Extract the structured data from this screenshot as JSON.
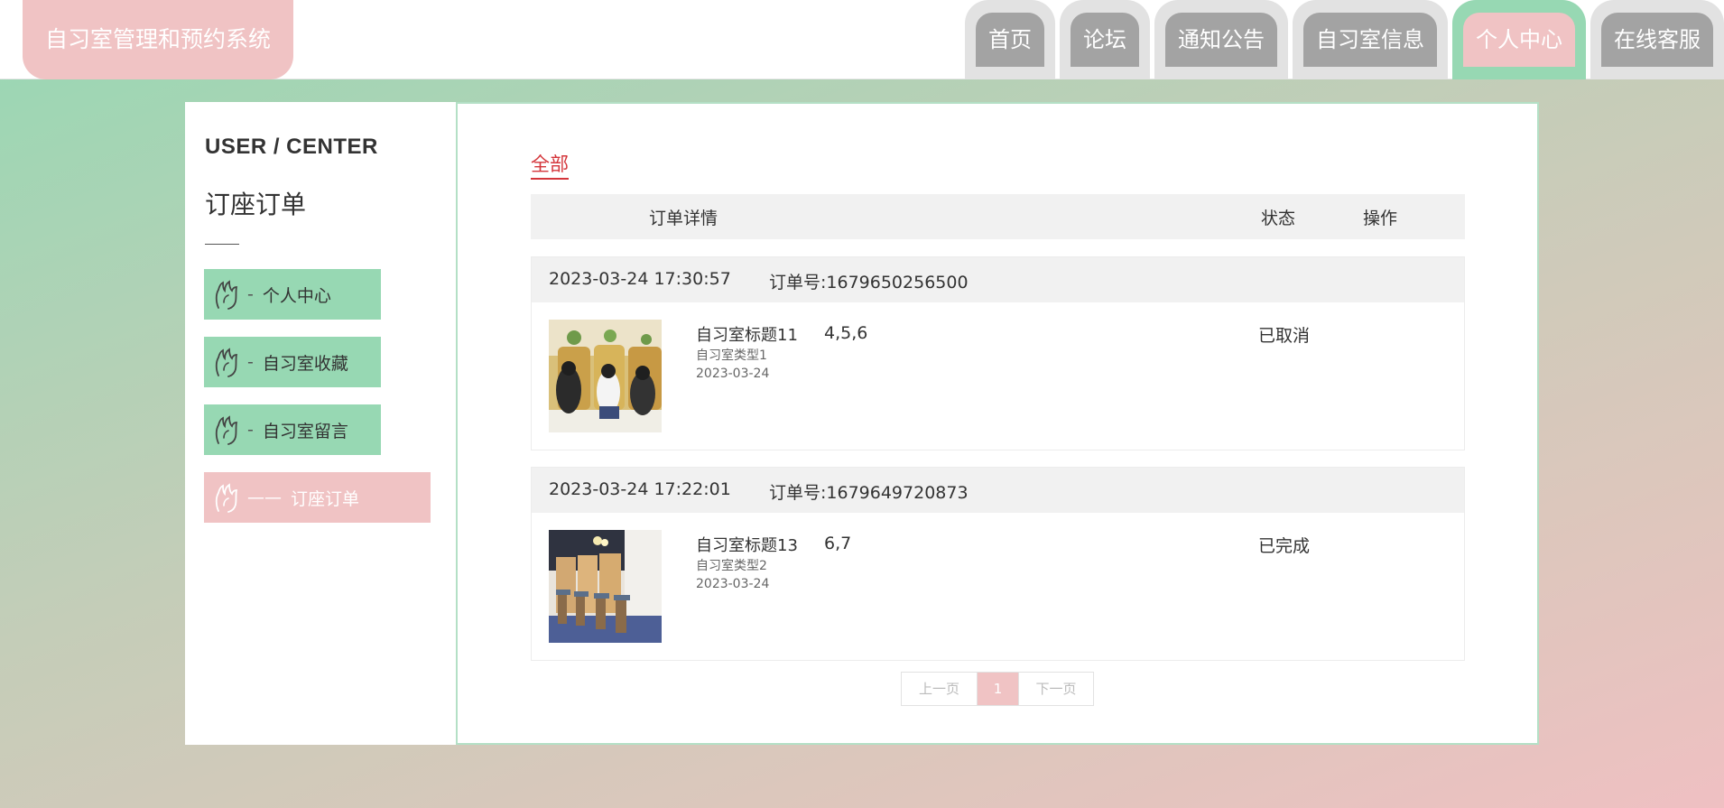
{
  "header": {
    "brand": "自习室管理和预约系统",
    "nav": [
      {
        "label": "首页",
        "active": false
      },
      {
        "label": "论坛",
        "active": false
      },
      {
        "label": "通知公告",
        "active": false
      },
      {
        "label": "自习室信息",
        "active": false
      },
      {
        "label": "个人中心",
        "active": true
      },
      {
        "label": "在线客服",
        "active": false
      }
    ]
  },
  "sidebar": {
    "eyebrow": "USER / CENTER",
    "title": "订座订单",
    "menu_icon": "hand-icon",
    "items": [
      {
        "dash": "-",
        "label": "个人中心",
        "active": false
      },
      {
        "dash": "-",
        "label": "自习室收藏",
        "active": false
      },
      {
        "dash": "-",
        "label": "自习室留言",
        "active": false
      },
      {
        "dash": "——",
        "label": "订座订单",
        "active": true
      }
    ]
  },
  "content": {
    "filter_tab": "全部",
    "columns": {
      "detail": "订单详情",
      "status": "状态",
      "action": "操作"
    },
    "orders": [
      {
        "datetime": "2023-03-24 17:30:57",
        "order_no": "订单号:1679650256500",
        "title": "自习室标题11",
        "type": "自习室类型1",
        "date": "2023-03-24",
        "seats": "4,5,6",
        "status": "已取消"
      },
      {
        "datetime": "2023-03-24 17:22:01",
        "order_no": "订单号:1679649720873",
        "title": "自习室标题13",
        "type": "自习室类型2",
        "date": "2023-03-24",
        "seats": "6,7",
        "status": "已完成"
      }
    ],
    "pager": {
      "prev": "上一页",
      "current": "1",
      "next": "下一页"
    }
  },
  "colors": {
    "mint": "#97d8b3",
    "pink": "#f0c3c4",
    "nav_gray": "#a3a3a3",
    "accent_red": "#d4353a"
  }
}
